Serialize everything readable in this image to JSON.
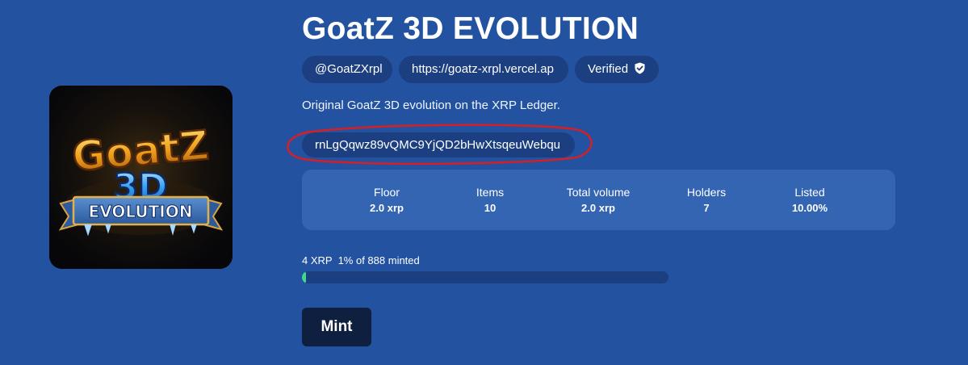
{
  "collection": {
    "title": "GoatZ 3D EVOLUTION",
    "description": "Original GoatZ 3D evolution on the XRP Ledger.",
    "logo": {
      "line1": "GoatZ",
      "line2": "3D",
      "line3": "EVOLUTION"
    }
  },
  "tags": {
    "handle": "@GoatZXrpl",
    "url": "https://goatz-xrpl.vercel.ap",
    "verified_label": "Verified",
    "verified_icon": "shield-check-icon"
  },
  "address": "rnLgQqwz89vQMC9YjQD2bHwXtsqeuWebqu",
  "stats": [
    {
      "label": "Floor",
      "value": "2.0 xrp"
    },
    {
      "label": "Items",
      "value": "10"
    },
    {
      "label": "Total volume",
      "value": "2.0 xrp"
    },
    {
      "label": "Holders",
      "value": "7"
    },
    {
      "label": "Listed",
      "value": "10.00%"
    }
  ],
  "mint": {
    "price": "4 XRP",
    "progress_text": "1% of 888 minted",
    "progress_percent": 1,
    "button_label": "Mint"
  },
  "colors": {
    "background": "#2352a0",
    "pill": "#1b3f80",
    "panel": "#3465b3",
    "progress_fill": "#3ddc84",
    "button": "#0f1f40",
    "annotation": "#d0202a"
  }
}
